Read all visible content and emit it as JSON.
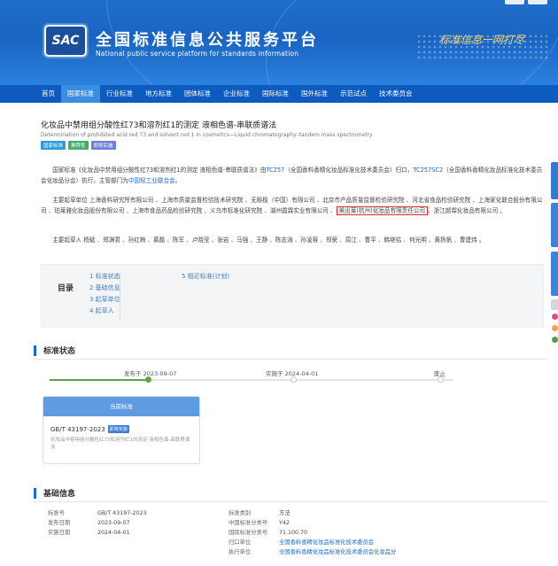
{
  "header": {
    "logo_text": "SAC",
    "title_cn": "全国标准信息公共服务平台",
    "title_en": "National public service platform  for standards information",
    "slogan": "标准信息一网打尽"
  },
  "nav": {
    "items": [
      "首页",
      "国家标准",
      "行业标准",
      "地方标准",
      "团体标准",
      "企业标准",
      "国际标准",
      "国外标准",
      "示范试点",
      "技术委员会"
    ],
    "active_index": 1
  },
  "standard": {
    "title": "化妆品中禁用组分酸性红73和溶剂红1的测定 液相色谱-串联质谱法",
    "subtitle": "Determination of prohibited acid red 73 and solvent red 1 in cosmetics—Liquid chromatography–tandem mass spectrometry",
    "tags": [
      {
        "label": "国家标准",
        "color": "#2f9ad8"
      },
      {
        "label": "推荐性",
        "color": "#3fb06b"
      },
      {
        "label": "即将实施",
        "color": "#6f7fd6"
      }
    ]
  },
  "paragraphs": {
    "p1_a": "国家标准《化妆品中禁用组分酸性红73和溶剂红1的测定 液相色谱-串联质谱法》由",
    "p1_tc1": "TC257",
    "p1_b": "（全国香料香精化妆品标准化技术委员会）归口，",
    "p1_tc2": "TC257SC2",
    "p1_c": "（全国香料香精化妆品标准化技术委员会化妆品分会）执行，主管部门为",
    "p1_dept": "中国轻工业联合会",
    "p1_d": "。",
    "p2_a": "主要起草单位 上海香料研究所有限公司 、上海市质量监督检验技术研究院 、无限极（中国）有限公司 、北京市产品质量监督检验研究院 、河北省食品检验研究院 、上海家化联合股份有限公司 、珀莱雅化妆品股份有限公司 、上海市食品药品检验研究院 、义乌市标准化研究院 、湖州霞霖实业有限公司 、",
    "p2_highlight": "美出莱(杭州)化妆品有限责任公司",
    "p2_b": "、浙江颜霏化妆品有限公司 。",
    "p3": "主要起草人 杨斌 、郑渊君 、孙红梅 、慕磊 、陈军 、卢晓莹 、张岩 、马强 、王静 、陈志涛 、孙凌蓉 、郑荣 、周江 、曹平 、韩继祜 、何光明 、黄扬帆 、曹建炜 。"
  },
  "toc": {
    "label": "目录",
    "col1": [
      "1  标准状态",
      "2  基础信息",
      "3  起草单位",
      "4  起草人"
    ],
    "col2": [
      "5  相近标准(计划)"
    ]
  },
  "status_section": {
    "title": "标准状态",
    "publish": "发布于 2023-09-07",
    "implement": "实施于 2024-04-01",
    "abolish": "废止",
    "progress": 0.5
  },
  "current_card": {
    "head": "当前标准",
    "code": "GB/T 43197-2023",
    "badge": "即将实施",
    "desc": "化妆品中禁用组分酸性红73和溶剂红1的测定 液相色谱-串联质谱法"
  },
  "basic_info": {
    "title": "基础信息",
    "left": [
      {
        "k": "标准号",
        "v": "GB/T 43197-2023"
      },
      {
        "k": "发布日期",
        "v": "2023-09-07"
      },
      {
        "k": "实施日期",
        "v": "2024-04-01"
      }
    ],
    "right": [
      {
        "k": "标准类别",
        "v": "方法"
      },
      {
        "k": "中国标准分类号",
        "v": "Y42"
      },
      {
        "k": "国际标准分类号",
        "v": "71.100.70"
      },
      {
        "k": "归口单位",
        "v": "全国香料香精化妆品标准化技术委员会",
        "link": true
      },
      {
        "k": "执行单位",
        "v": "全国香料香精化妆品标准化技术委员会化妆品分",
        "link": true
      }
    ]
  }
}
